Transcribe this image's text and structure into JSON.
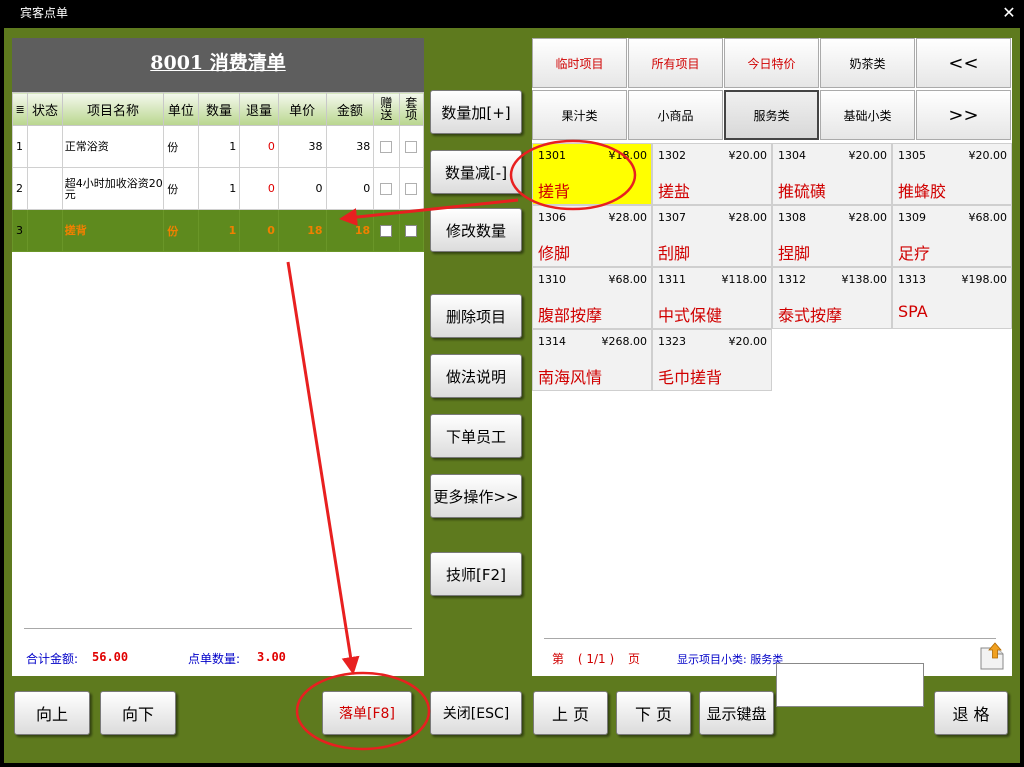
{
  "window": {
    "title": "宾客点单"
  },
  "order": {
    "heading": "8001  消费清单",
    "columns": [
      "≣",
      "状态",
      "项目名称",
      "单位",
      "数量",
      "退量",
      "单价",
      "金额",
      "赠送",
      "套项"
    ],
    "rows": [
      {
        "idx": "1",
        "name": "正常浴资",
        "unit": "份",
        "qty": "1",
        "ret": "0",
        "price": "38",
        "amount": "38"
      },
      {
        "idx": "2",
        "name": "超4小时加收浴资20元",
        "unit": "份",
        "qty": "1",
        "ret": "0",
        "price": "0",
        "amount": "0"
      },
      {
        "idx": "3",
        "name": "搓背",
        "unit": "份",
        "qty": "1",
        "ret": "0",
        "price": "18",
        "amount": "18"
      }
    ],
    "summary": {
      "total_label": "合计金额:",
      "total_value": "56.00",
      "count_label": "点单数量:",
      "count_value": "3.00"
    }
  },
  "actions": {
    "qty_plus": "数量加[+]",
    "qty_minus": "数量减[-]",
    "edit_qty": "修改数量",
    "delete_item": "删除项目",
    "method_note": "做法说明",
    "order_staff": "下单员工",
    "more_ops": "更多操作>>",
    "technician": "技师[F2]"
  },
  "tabs": {
    "row1": [
      "临时项目",
      "所有项目",
      "今日特价",
      "奶茶类",
      "<<"
    ],
    "row2": [
      "果汁类",
      "小商品",
      "服务类",
      "基础小类",
      ">>"
    ],
    "active": "服务类"
  },
  "items": [
    {
      "code": "1301",
      "price": "¥18.00",
      "name": "搓背"
    },
    {
      "code": "1302",
      "price": "¥20.00",
      "name": "搓盐"
    },
    {
      "code": "1304",
      "price": "¥20.00",
      "name": "推硫磺"
    },
    {
      "code": "1305",
      "price": "¥20.00",
      "name": "推蜂胶"
    },
    {
      "code": "1306",
      "price": "¥28.00",
      "name": "修脚"
    },
    {
      "code": "1307",
      "price": "¥28.00",
      "name": "刮脚"
    },
    {
      "code": "1308",
      "price": "¥28.00",
      "name": "捏脚"
    },
    {
      "code": "1309",
      "price": "¥68.00",
      "name": "足疗"
    },
    {
      "code": "1310",
      "price": "¥68.00",
      "name": "腹部按摩"
    },
    {
      "code": "1311",
      "price": "¥118.00",
      "name": "中式保健"
    },
    {
      "code": "1312",
      "price": "¥138.00",
      "name": "泰式按摩"
    },
    {
      "code": "1313",
      "price": "¥198.00",
      "name": "SPA"
    },
    {
      "code": "1314",
      "price": "¥268.00",
      "name": "南海风情"
    },
    {
      "code": "1323",
      "price": "¥20.00",
      "name": "毛巾搓背"
    }
  ],
  "paging": {
    "page_word": "第",
    "page": "( 1/1 )",
    "page_suffix": "页",
    "category_label": "显示项目小类: 服务类"
  },
  "bottom": {
    "up": "向上",
    "down": "向下",
    "submit": "落单[F8]",
    "close": "关闭[ESC]",
    "prev_page": "上 页",
    "next_page": "下 页",
    "show_keyboard": "显示键盘",
    "backspace": "退 格"
  },
  "colors": {
    "frame": "#5e7a1e",
    "selected_row": "#5e8a1e",
    "highlight_item": "#ffff00",
    "annotation": "#e82020"
  }
}
